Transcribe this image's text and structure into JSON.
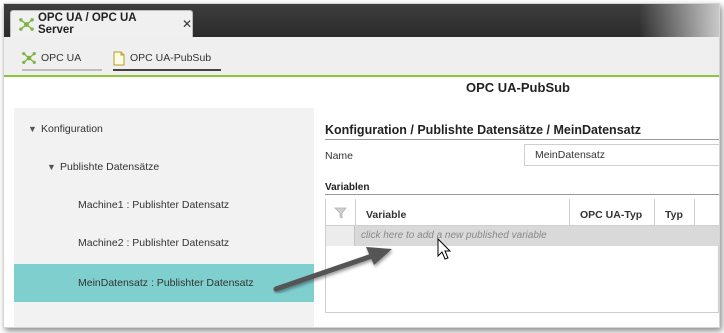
{
  "window": {
    "main_tab_label": "OPC UA / OPC UA Server",
    "close_glyph": "✕"
  },
  "sub_tabs": [
    {
      "label": "OPC UA",
      "icon": "opcua-node-icon"
    },
    {
      "label": "OPC UA-PubSub",
      "icon": "document-icon"
    }
  ],
  "page_title": "OPC UA-PubSub",
  "sidebar": {
    "items": [
      {
        "label": "Konfiguration",
        "expanded": true
      },
      {
        "label": "Publishte Datensätze",
        "expanded": true
      },
      {
        "label": "Machine1 : Publishter Datensatz"
      },
      {
        "label": "Machine2 : Publishter Datensatz"
      },
      {
        "label": "MeinDatensatz : Publishter Datensatz",
        "selected": true
      }
    ]
  },
  "content": {
    "breadcrumb": "Konfiguration / Publishte Datensätze / MeinDatensatz",
    "name_label": "Name",
    "name_value": "MeinDatensatz",
    "variables_label": "Variablen",
    "grid": {
      "columns": [
        "Variable",
        "OPC UA-Typ",
        "Typ"
      ],
      "add_row_text": "click here to add a new published variable"
    }
  },
  "colors": {
    "accent_green": "#8cc43c",
    "selected_teal": "#7fcfcf"
  }
}
